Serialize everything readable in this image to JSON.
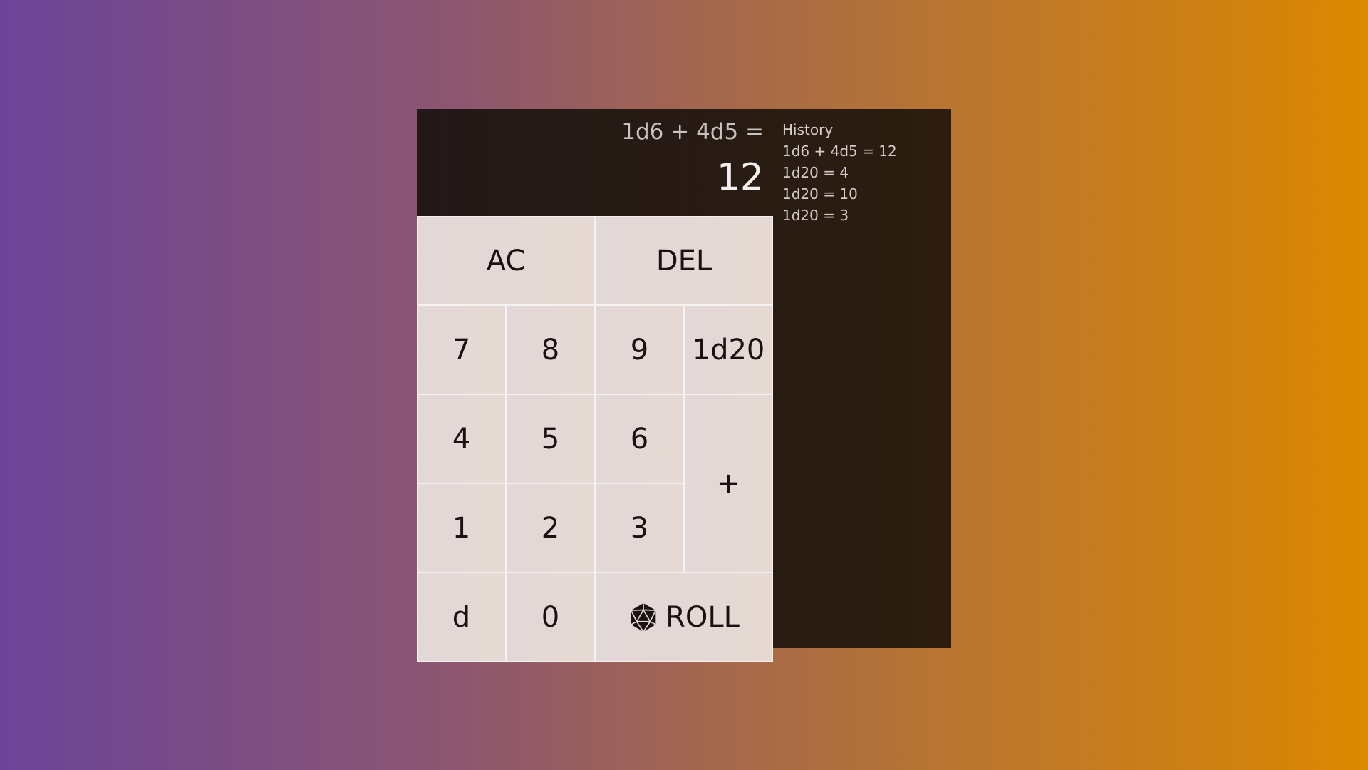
{
  "display": {
    "expression": "1d6 + 4d5 =",
    "result": "12"
  },
  "history": {
    "title": "History",
    "items": [
      "1d6 + 4d5 = 12",
      "1d20 = 4",
      "1d20 = 10",
      "1d20 = 3"
    ]
  },
  "keys": {
    "ac": "AC",
    "del": "DEL",
    "k7": "7",
    "k8": "8",
    "k9": "9",
    "d20": "1d20",
    "k4": "4",
    "k5": "5",
    "k6": "6",
    "plus": "+",
    "k1": "1",
    "k2": "2",
    "k3": "3",
    "d": "d",
    "k0": "0",
    "roll": "ROLL",
    "roll_icon": "d20-die-icon"
  },
  "colors": {
    "app_bg": "#2a1c12",
    "key_bg": "#e4d8d5",
    "key_text": "#1a1212",
    "display_text": "#f4eeee"
  }
}
